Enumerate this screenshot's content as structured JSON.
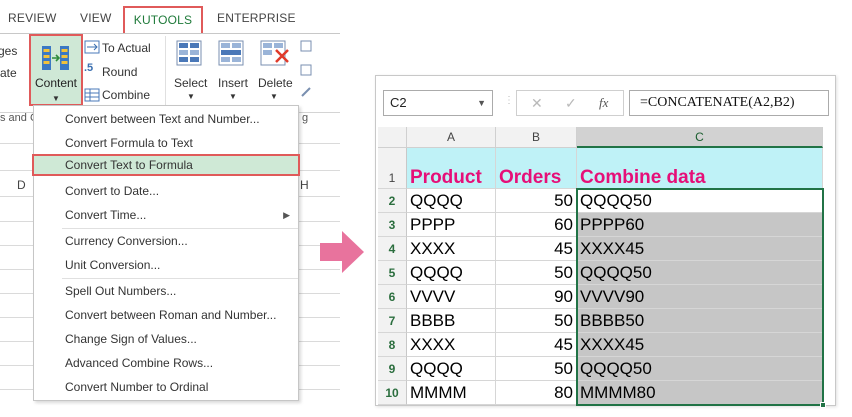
{
  "ribbon": {
    "tabs": [
      "REVIEW",
      "VIEW",
      "KUTOOLS",
      "ENTERPRISE"
    ],
    "left_partial": [
      "ges",
      "ate"
    ],
    "group_partial": "s and C",
    "content_label": "Content",
    "to_actual": "To Actual",
    "round": "Round",
    "combine": "Combine",
    "select": "Select",
    "insert": "Insert",
    "delete": "Delete",
    "group_partial_right": "g",
    "col_d": "D",
    "col_h": "H"
  },
  "menu": {
    "items": [
      {
        "label": "Convert between Text and Number...",
        "sub": false,
        "hl": false
      },
      {
        "label": "Convert Formula to Text",
        "sub": false,
        "hl": false
      },
      {
        "label": "Convert Text to Formula",
        "sub": false,
        "hl": true
      },
      {
        "label": "Convert to Date...",
        "sub": false,
        "hl": false
      },
      {
        "label": "Convert Time...",
        "sub": true,
        "hl": false
      },
      {
        "label": "Currency Conversion...",
        "sub": false,
        "hl": false
      },
      {
        "label": "Unit Conversion...",
        "sub": false,
        "hl": false
      },
      {
        "label": "Spell Out Numbers...",
        "sub": false,
        "hl": false
      },
      {
        "label": "Convert between Roman and Number...",
        "sub": false,
        "hl": false
      },
      {
        "label": "Change Sign of Values...",
        "sub": false,
        "hl": false
      },
      {
        "label": "Advanced Combine Rows...",
        "sub": false,
        "hl": false
      },
      {
        "label": "Convert Number to Ordinal",
        "sub": false,
        "hl": false
      }
    ]
  },
  "sheet": {
    "name_box": "C2",
    "formula": "=CONCATENATE(A2,B2)",
    "fx": "fx",
    "columns": [
      "A",
      "B",
      "C"
    ],
    "header_row": {
      "row": "1",
      "a": "Product",
      "b": "Orders",
      "c": "Combine data"
    },
    "rows": [
      {
        "row": "2",
        "a": "QQQQ",
        "b": "50",
        "c": "QQQQ50"
      },
      {
        "row": "3",
        "a": "PPPP",
        "b": "60",
        "c": "PPPP60"
      },
      {
        "row": "4",
        "a": "XXXX",
        "b": "45",
        "c": "XXXX45"
      },
      {
        "row": "5",
        "a": "QQQQ",
        "b": "50",
        "c": "QQQQ50"
      },
      {
        "row": "6",
        "a": "VVVV",
        "b": "90",
        "c": "VVVV90"
      },
      {
        "row": "7",
        "a": "BBBB",
        "b": "50",
        "c": "BBBB50"
      },
      {
        "row": "8",
        "a": "XXXX",
        "b": "45",
        "c": "XXXX45"
      },
      {
        "row": "9",
        "a": "QQQQ",
        "b": "50",
        "c": "QQQQ50"
      },
      {
        "row": "10",
        "a": "MMMM",
        "b": "80",
        "c": "MMMM80"
      }
    ]
  },
  "colors": {
    "kutools_green": "#1f7a3a",
    "highlight_red": "#e05a5a",
    "header_fill": "#bff2f7",
    "header_text": "#e60f78",
    "arrow_pink": "#e8739d",
    "excel_green": "#217346"
  }
}
